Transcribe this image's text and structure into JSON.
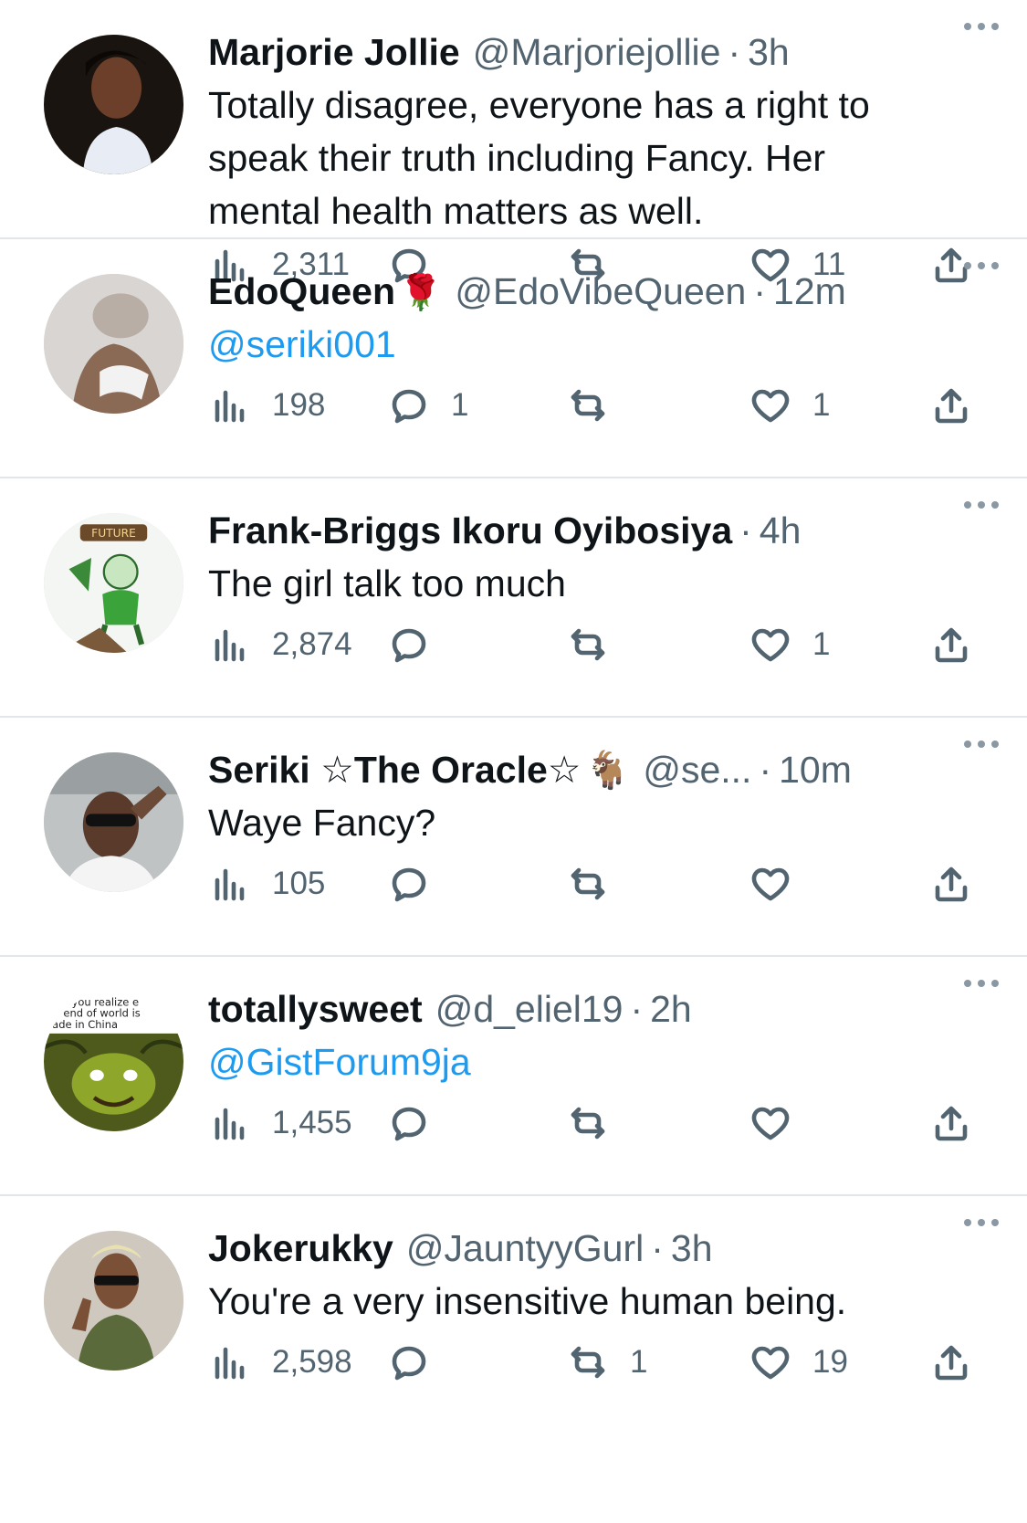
{
  "tweets": [
    {
      "name": "Marjorie Jollie",
      "name_icon": "",
      "handle": "@Marjoriejollie",
      "time": "3h",
      "text": "Totally disagree, everyone has a right to\nspeak their truth including Fancy. Her\nmental health matters as well.",
      "is_mention": false,
      "views": "2,311",
      "replies": "",
      "retweets": "",
      "likes": "11"
    },
    {
      "name": "EdoQueen",
      "name_icon": "🌹",
      "handle": "@EdoVibeQueen",
      "time": "12m",
      "text": "@seriki001",
      "is_mention": true,
      "views": "198",
      "replies": "1",
      "retweets": "",
      "likes": "1"
    },
    {
      "name": "Frank-Briggs Ikoru Oyibosiya",
      "name_icon": "",
      "handle": "",
      "time": "4h",
      "text": "The girl talk too much",
      "is_mention": false,
      "views": "2,874",
      "replies": "",
      "retweets": "",
      "likes": "1"
    },
    {
      "name": "Seriki ☆The Oracle☆",
      "name_icon": "🐐",
      "handle": "@se...",
      "time": "10m",
      "text": "Waye Fancy?",
      "is_mention": false,
      "views": "105",
      "replies": "",
      "retweets": "",
      "likes": ""
    },
    {
      "name": "totallysweet",
      "name_icon": "",
      "handle": "@d_eliel19",
      "time": "2h",
      "text": "@GistForum9ja",
      "is_mention": true,
      "views": "1,455",
      "replies": "",
      "retweets": "",
      "likes": ""
    },
    {
      "name": "Jokerukky",
      "name_icon": "",
      "handle": "@JauntyyGurl",
      "time": "3h",
      "text": "You're a very insensitive human being.",
      "is_mention": false,
      "views": "2,598",
      "replies": "",
      "retweets": "1",
      "likes": "19"
    }
  ],
  "avatar_5_caption": "you realize e\nend of world is\nade in China",
  "avatar_3_caption": "FUTURE",
  "icons": {
    "views": "bar-chart-icon",
    "reply": "speech-bubble-icon",
    "retweet": "retweet-arrows-icon",
    "like": "heart-icon",
    "share": "share-upload-icon",
    "more": "more-dots-icon"
  },
  "colors": {
    "text": "#0f1419",
    "secondary": "#536471",
    "mention": "#1d9bf0",
    "divider": "#e3e6e8"
  }
}
